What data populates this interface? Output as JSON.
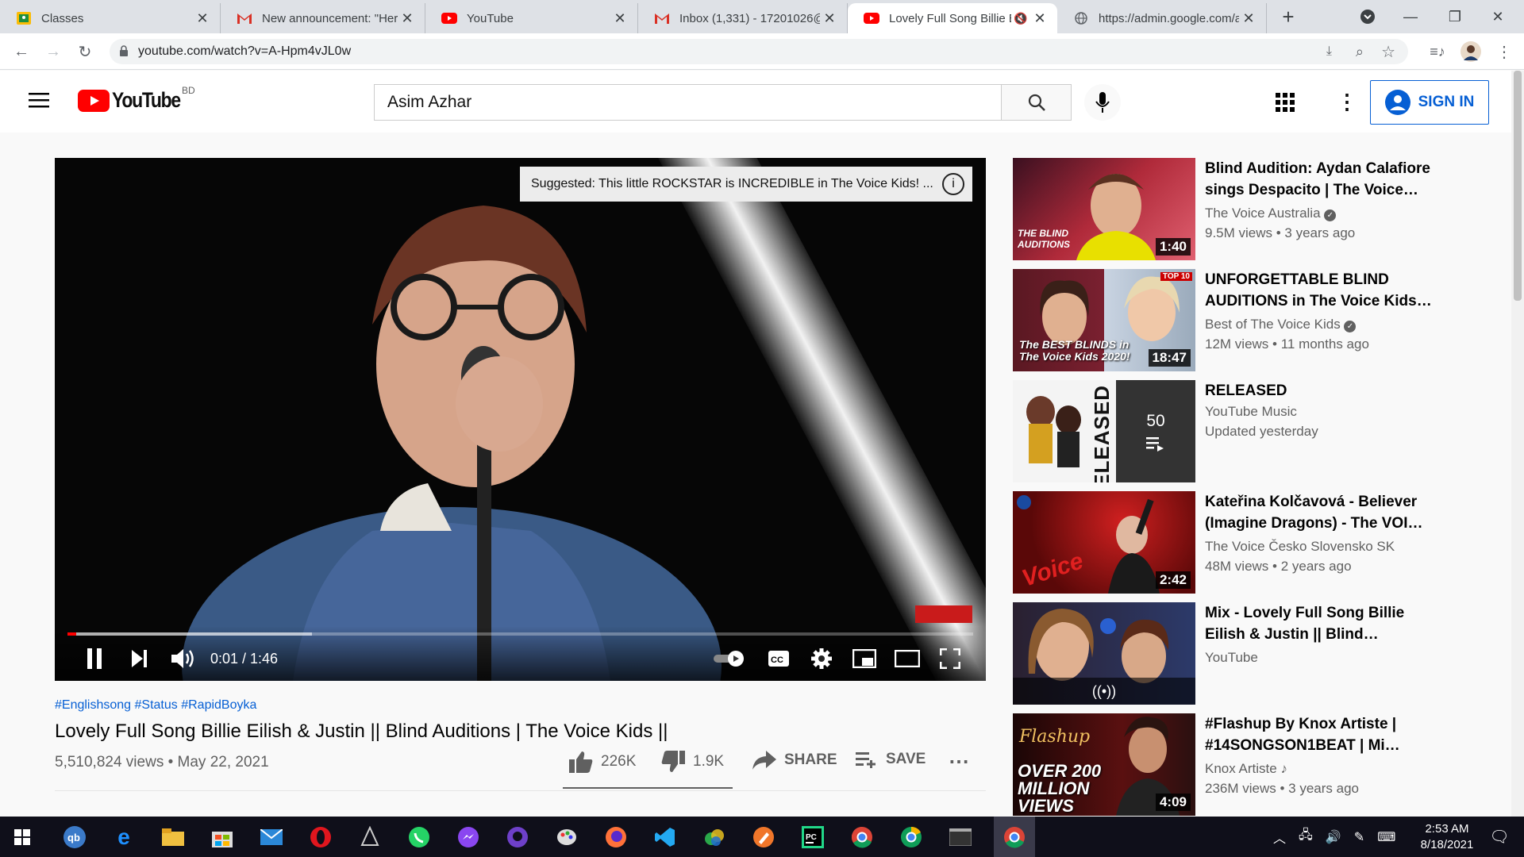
{
  "tabs": [
    {
      "title": "Classes",
      "favicon": "google-classroom-icon",
      "color": "#fbbc04"
    },
    {
      "title": "New announcement: \"Here",
      "favicon": "gmail-icon",
      "color": "#d93025"
    },
    {
      "title": "YouTube",
      "favicon": "youtube-icon",
      "color": "#ff0000"
    },
    {
      "title": "Inbox (1,331) - 17201026@",
      "favicon": "gmail-icon",
      "color": "#d93025"
    },
    {
      "title": "Lovely Full Song Billie E",
      "favicon": "youtube-icon",
      "color": "#ff0000",
      "active": true
    },
    {
      "title": "https://admin.google.com/a",
      "favicon": "globe-icon",
      "color": "#5f6368"
    }
  ],
  "address": {
    "url": "youtube.com/watch?v=A-Hpm4vJL0w"
  },
  "yt": {
    "logo_text": "YouTube",
    "region": "BD",
    "search_value": "Asim Azhar",
    "signin": "SIGN IN"
  },
  "player": {
    "suggestion": "Suggested: This little ROCKSTAR is INCREDIBLE in The Voice Kids! ...",
    "time": "0:01 / 1:46",
    "progress": 0.01,
    "buffered": 0.27
  },
  "video": {
    "hashtags": "#Englishsong #Status #RapidBoyka",
    "title": "Lovely Full Song Billie Eilish & Justin || Blind Auditions | The Voice Kids ||",
    "stats": "5,510,824 views • May 22, 2021",
    "likes": "226K",
    "dislikes": "1.9K",
    "share": "SHARE",
    "save": "SAVE"
  },
  "related": [
    {
      "title": "Blind Audition: Aydan Calafiore sings Despacito | The Voice…",
      "channel": "The Voice Australia",
      "verified": true,
      "views": "9.5M views • 3 years ago",
      "duration": "1:40",
      "thumb_color": "#b02a3a",
      "thumb_text": "THE BLIND AUDITIONS"
    },
    {
      "title": "UNFORGETTABLE BLIND AUDITIONS in The Voice Kids…",
      "channel": "Best of The Voice Kids",
      "verified": true,
      "views": "12M views • 11 months ago",
      "duration": "18:47",
      "thumb_color": "#7a2030",
      "thumb_text": "The BEST BLINDS in The Voice Kids 2020!",
      "thumb_badge": "TOP 10"
    },
    {
      "title": "RELEASED",
      "channel": "YouTube Music",
      "verified": false,
      "views": "Updated yesterday",
      "playlist_count": "50",
      "thumb_color": "#ffffff",
      "thumb_text": "RELEASED"
    },
    {
      "title": "Kateřina Kolčavová - Believer (Imagine Dragons) - The VOI…",
      "channel": "The Voice Česko Slovensko SK",
      "verified": false,
      "views": "48M views • 2 years ago",
      "duration": "2:42",
      "thumb_color": "#8a0d12"
    },
    {
      "title": "Mix - Lovely Full Song Billie Eilish & Justin || Blind…",
      "channel": "YouTube",
      "verified": false,
      "views": "",
      "thumb_color": "#2c3a6a"
    },
    {
      "title": "#Flashup By Knox Artiste | #14SONGSON1BEAT | Mi…",
      "channel": "Knox Artiste",
      "music_note": true,
      "views": "236M views • 3 years ago",
      "duration": "4:09",
      "thumb_color": "#5a1010",
      "thumb_text": "OVER 200 MILLION VIEWS"
    }
  ],
  "taskbar": {
    "time": "2:53 AM",
    "date": "8/18/2021"
  }
}
